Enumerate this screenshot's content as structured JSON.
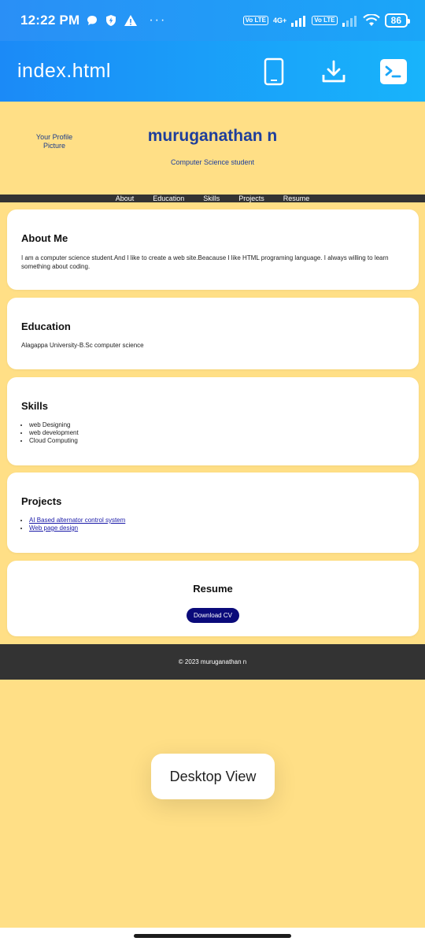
{
  "status": {
    "time": "12:22 PM",
    "overflow": "···",
    "volte1": "Vo LTE",
    "volte2": "Vo LTE",
    "net": "4G+",
    "battery": "86"
  },
  "app": {
    "title": "index.html"
  },
  "site": {
    "profile_pic_alt": "Your Profile Picture",
    "name": "muruganathan n",
    "subtitle": "Computer Science student",
    "nav": [
      "About",
      "Education",
      "Skills",
      "Projects",
      "Resume"
    ],
    "about": {
      "heading": "About Me",
      "text": "I am a computer science student.And I like to create a web site.Beacause I like HTML programing language. I always willing to learn something about coding."
    },
    "education": {
      "heading": "Education",
      "text": "Alagappa University-B.Sc computer science"
    },
    "skills": {
      "heading": "Skills",
      "items": [
        "web Designing",
        "web development",
        "Cloud Computing"
      ]
    },
    "projects": {
      "heading": "Projects",
      "items": [
        "AI Based alternator control system",
        "Web page design"
      ]
    },
    "resume": {
      "heading": "Resume",
      "button": "Download CV"
    },
    "footer": "© 2023 muruganathan n"
  },
  "toast": {
    "label": "Desktop View"
  },
  "colors": {
    "page_bg": "#ffdf86",
    "app_bar": "#1b8af7",
    "title_blue": "#1e3e9c",
    "nav_bg": "#333333",
    "cv_button": "#0a0a7a"
  }
}
